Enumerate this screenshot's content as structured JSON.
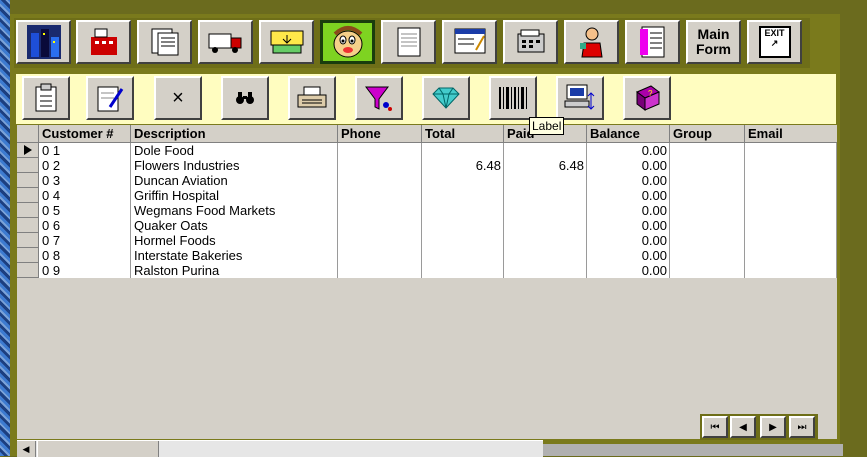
{
  "toolbar_main": {
    "buttons": [
      {
        "icon": "city-icon"
      },
      {
        "icon": "cash-register-icon"
      },
      {
        "icon": "documents-icon"
      },
      {
        "icon": "truck-icon"
      },
      {
        "icon": "money-icon"
      },
      {
        "icon": "cartoon-face-icon",
        "active": true
      },
      {
        "icon": "document-icon"
      },
      {
        "icon": "window-form-icon"
      },
      {
        "icon": "calculator-icon"
      },
      {
        "icon": "person-icon"
      },
      {
        "icon": "list-icon"
      },
      {
        "label_line1": "Main",
        "label_line2": "Form"
      },
      {
        "exit_label": "EXIT"
      }
    ]
  },
  "toolbar_secondary": {
    "buttons": [
      {
        "icon": "clipboard-icon"
      },
      {
        "icon": "edit-note-icon"
      },
      {
        "label": "×"
      },
      {
        "icon": "binoculars-icon"
      },
      {
        "icon": "typewriter-icon"
      },
      {
        "icon": "filter-funnel-icon"
      },
      {
        "icon": "diamond-icon"
      },
      {
        "icon": "barcode-icon"
      },
      {
        "icon": "computer-icon"
      },
      {
        "icon": "book-icon"
      }
    ]
  },
  "tooltip": "Label",
  "table": {
    "columns": [
      "Customer #",
      "Description",
      "Phone",
      "Total",
      "Paid",
      "Balance",
      "Group",
      "Email"
    ],
    "rows": [
      {
        "id": "0 1",
        "desc": "Dole Food",
        "phone": "",
        "total": "",
        "paid": "",
        "balance": "0.00"
      },
      {
        "id": "0 2",
        "desc": "Flowers Industries",
        "phone": "",
        "total": "6.48",
        "paid": "6.48",
        "balance": "0.00"
      },
      {
        "id": "0 3",
        "desc": "Duncan Aviation",
        "phone": "",
        "total": "",
        "paid": "",
        "balance": "0.00"
      },
      {
        "id": "0 4",
        "desc": "Griffin Hospital",
        "phone": "",
        "total": "",
        "paid": "",
        "balance": "0.00"
      },
      {
        "id": "0 5",
        "desc": "Wegmans Food Markets",
        "phone": "",
        "total": "",
        "paid": "",
        "balance": "0.00"
      },
      {
        "id": "0 6",
        "desc": "Quaker Oats",
        "phone": "",
        "total": "",
        "paid": "",
        "balance": "0.00"
      },
      {
        "id": "0 7",
        "desc": "Hormel Foods",
        "phone": "",
        "total": "",
        "paid": "",
        "balance": "0.00"
      },
      {
        "id": "0 8",
        "desc": "Interstate Bakeries",
        "phone": "",
        "total": "",
        "paid": "",
        "balance": "0.00"
      },
      {
        "id": "0 9",
        "desc": "Ralston Purina",
        "phone": "",
        "total": "",
        "paid": "",
        "balance": "0.00"
      }
    ]
  }
}
